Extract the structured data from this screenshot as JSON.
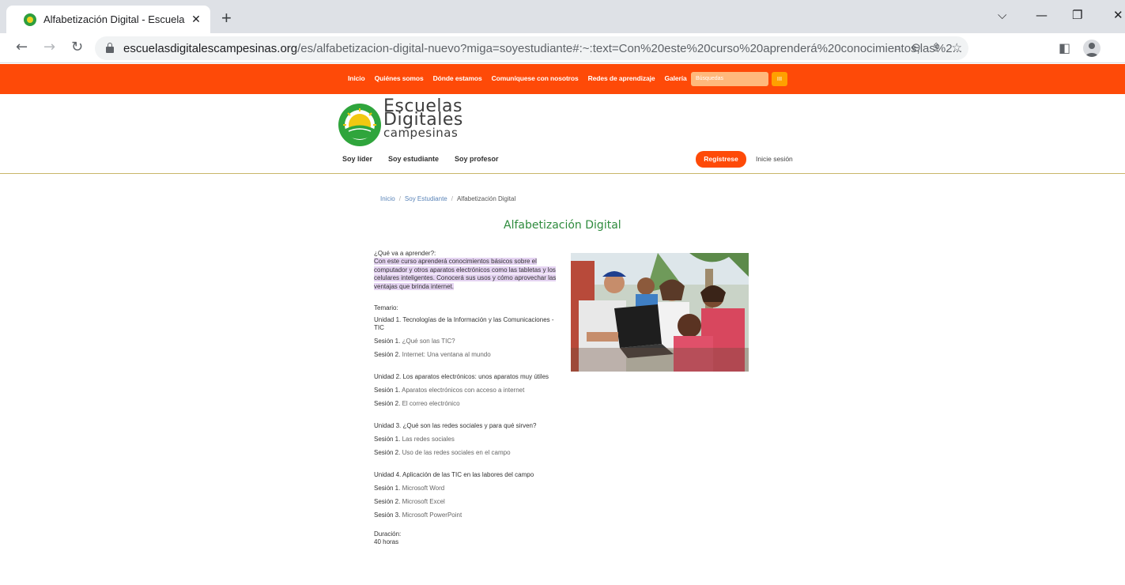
{
  "browser": {
    "tab_title": "Alfabetización Digital - Escuelas D",
    "url_host": "escuelasdigitalescampesinas.org",
    "url_path": "/es/alfabetizacion-digital-nuevo?miga=soyestudiante#:~:text=Con%20este%20curso%20aprenderá%20conocimientos,las%2..."
  },
  "site_nav": {
    "items": [
      "Inicio",
      "Quiénes somos",
      "Dónde estamos",
      "Comuníquese con nosotros",
      "Redes de aprendizaje",
      "Galería"
    ],
    "search_placeholder": "Búsquedas",
    "search_button": "III"
  },
  "logo": {
    "line1": "Escuelas",
    "line2": "Digitales",
    "line3": "campesinas"
  },
  "user_nav": {
    "items": [
      "Soy líder",
      "Soy estudiante",
      "Soy profesor"
    ],
    "register": "Regístrese",
    "login": "Inicie sesión"
  },
  "breadcrumb": {
    "home": "Inicio",
    "section": "Soy Estudiante",
    "current": "Alfabetización Digital",
    "separator": "/"
  },
  "page": {
    "title": "Alfabetización Digital",
    "question": "¿Qué va a aprender?:",
    "description": "Con este curso aprenderá conocimientos básicos sobre el computador y otros aparatos electrónicos como las tabletas y los celulares inteligentes. Conocerá sus usos y cómo aprovechar las ventajas que brinda internet.",
    "temario_label": "Temario:",
    "units": [
      {
        "title": "Unidad 1. Tecnologías de la Información y las Comunicaciones - TIC",
        "sessions": [
          {
            "label": "Sesión 1.",
            "text": "¿Qué son las TIC?"
          },
          {
            "label": "Sesión 2.",
            "text": "Internet: Una ventana al mundo"
          }
        ]
      },
      {
        "title": "Unidad 2. Los aparatos electrónicos: unos aparatos muy útiles",
        "sessions": [
          {
            "label": "Sesión 1.",
            "text": "Aparatos electrónicos con acceso a internet"
          },
          {
            "label": "Sesión 2.",
            "text": "El correo electrónico"
          }
        ]
      },
      {
        "title": "Unidad 3. ¿Qué son las redes sociales y para qué sirven?",
        "sessions": [
          {
            "label": "Sesión 1.",
            "text": "Las redes sociales"
          },
          {
            "label": "Sesión 2.",
            "text": "Uso de las redes sociales en el campo"
          }
        ]
      },
      {
        "title": "Unidad 4. Aplicación de las TIC en las labores del campo",
        "sessions": [
          {
            "label": "Sesión 1.",
            "text": "Microsoft Word"
          },
          {
            "label": "Sesión 2.",
            "text": "Microsoft Excel"
          },
          {
            "label": "Sesión 3.",
            "text": "Microsoft PowerPoint"
          }
        ]
      }
    ],
    "duration_label": "Duración:",
    "duration_value": "40 horas"
  },
  "colors": {
    "brand_orange": "#fe4a08",
    "title_green": "#2e8b3d",
    "highlight": "#e5d4f2"
  }
}
